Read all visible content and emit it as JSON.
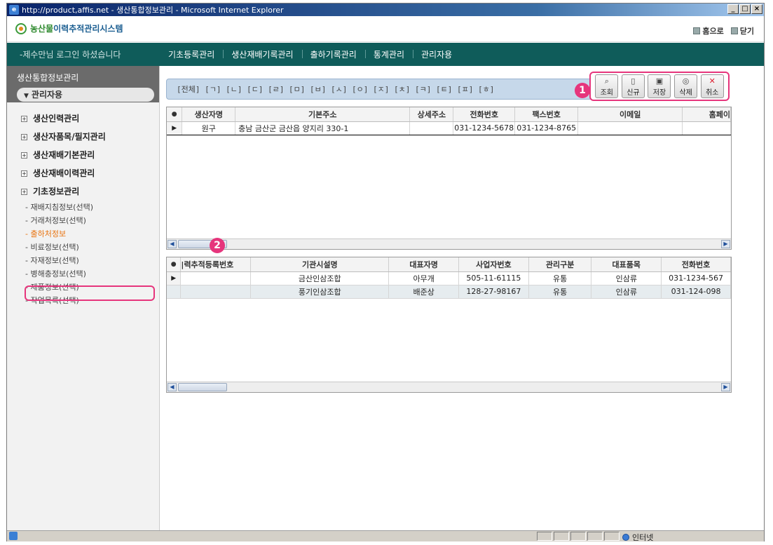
{
  "window": {
    "title": "http://product,affis.net - 생산통합정보관리 - Microsoft Internet Explorer",
    "controls": [
      "_",
      "□",
      "×"
    ]
  },
  "header": {
    "app_name_part1": "농산물",
    "app_name_part2": "이력추적관리시스템",
    "home_link": "홈으로",
    "close_link": "닫기"
  },
  "nav": {
    "welcome": "-제수만님 로그인 하셨습니다",
    "menu": [
      "기초등록관리",
      "생산재배기록관리",
      "출하기록관리",
      "통계관리",
      "관리자용"
    ]
  },
  "sidebar": {
    "section_title": "생산통합정보관리",
    "admin_label": "관리자용",
    "tree": [
      "생산인력관리",
      "생산자품목/필지관리",
      "생산재배기본관리",
      "생산재배이력관리",
      "기초정보관리"
    ],
    "sub_items": [
      "- 재배지침정보(선택)",
      "- 거래처정보(선택)",
      "- 출하처정보",
      "- 비료정보(선택)",
      "- 자재정보(선택)",
      "- 병해충정보(선택)",
      "- 제품정보(선택)",
      "- 작업목록(선택)"
    ],
    "active_index": 2
  },
  "filter": {
    "text": "[전체] [ㄱ] [ㄴ] [ㄷ] [ㄹ] [ㅁ] [ㅂ] [ㅅ] [ㅇ] [ㅈ] [ㅊ] [ㅋ] [ㅌ] [ㅍ] [ㅎ]"
  },
  "toolbar": {
    "search": "조회",
    "new": "신규",
    "save": "저장",
    "delete": "삭제",
    "cancel": "취소"
  },
  "badges": {
    "one": "1",
    "two": "2"
  },
  "grid_top": {
    "columns": [
      "생산자명",
      "기본주소",
      "상세주소",
      "전화번호",
      "팩스번호",
      "이메일",
      "홈페이"
    ],
    "rows": [
      [
        "원구",
        "충남 금산군 금산읍 양지리  330-1",
        "",
        "031-1234-5678",
        "031-1234-8765",
        "",
        ""
      ]
    ]
  },
  "grid_bottom": {
    "columns": [
      "|력추적등록번호",
      "기관시설명",
      "대표자명",
      "사업자번호",
      "관리구분",
      "대표품목",
      "전화번호"
    ],
    "rows": [
      [
        "",
        "금산인삼조합",
        "아무개",
        "505-11-61115",
        "유통",
        "인삼류",
        "031-1234-567"
      ],
      [
        "",
        "풍기인삼조합",
        "배준상",
        "128-27-98167",
        "유통",
        "인삼류",
        "031-124-098"
      ]
    ]
  },
  "status": {
    "zone": "인터넷"
  },
  "colors": {
    "nav": "#0f5c5a",
    "highlight": "#e6357c",
    "active_link": "#e8730f"
  }
}
